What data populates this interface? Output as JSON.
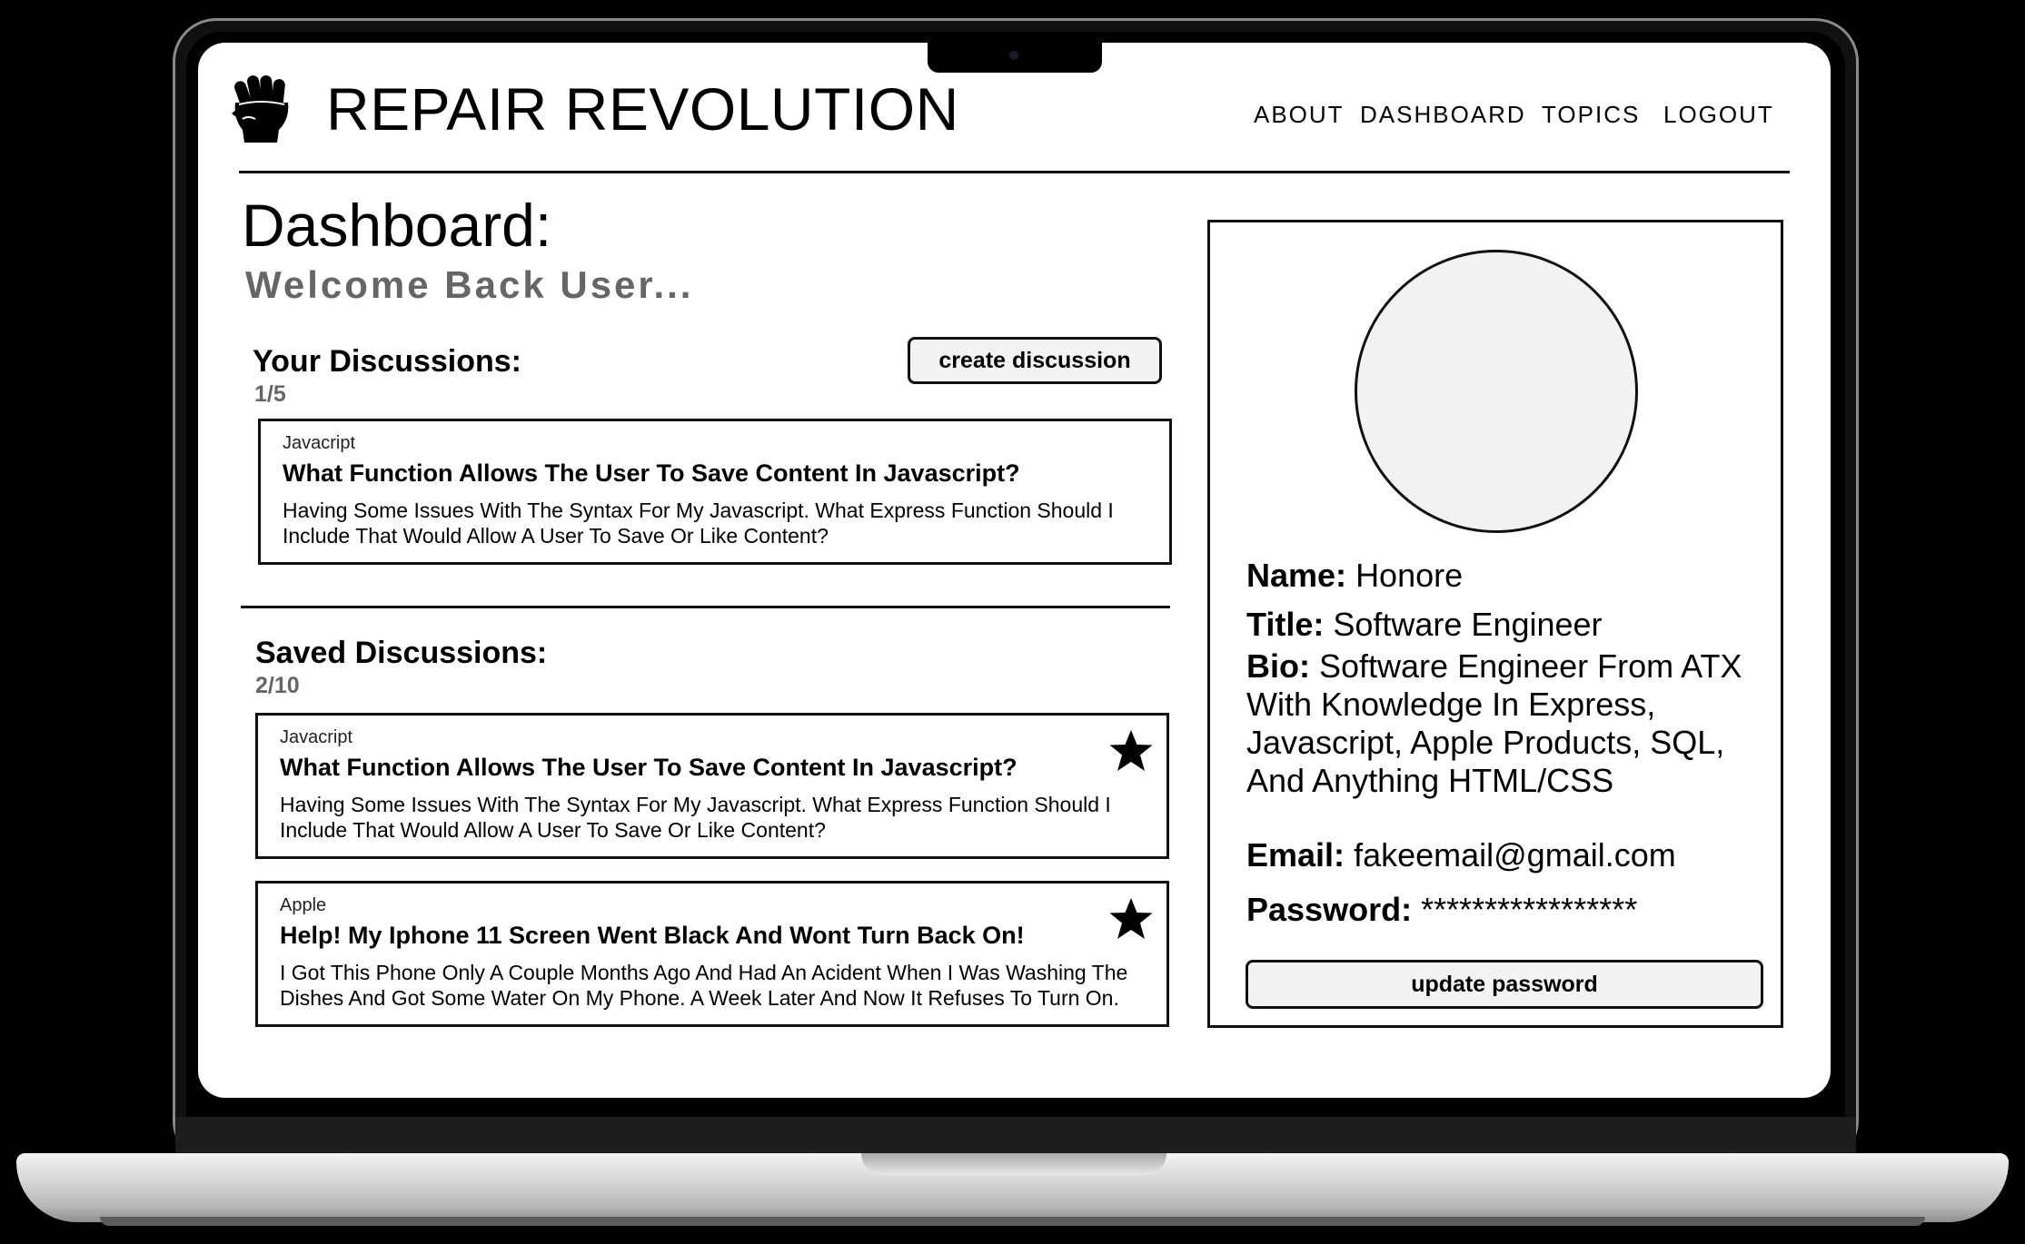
{
  "app": {
    "brand": "REPAIR REVOLUTION"
  },
  "nav": {
    "items": [
      {
        "label": "ABOUT"
      },
      {
        "label": "DASHBOARD"
      },
      {
        "label": "TOPICS"
      },
      {
        "label": "LOGOUT"
      }
    ]
  },
  "dashboard": {
    "title": "Dashboard:",
    "welcome": "Welcome Back User..."
  },
  "your_discussions": {
    "title": "Your Discussions:",
    "count": "1/5",
    "create_label": "create discussion",
    "items": [
      {
        "topic": "Javacript",
        "title": "What Function Allows The User To Save Content In Javascript?",
        "body": "Having Some Issues With The Syntax For My Javascript. What Express Function Should I Include That Would Allow A User To Save Or Like Content?"
      }
    ]
  },
  "saved_discussions": {
    "title": "Saved Discussions:",
    "count": "2/10",
    "items": [
      {
        "topic": "Javacript",
        "title": "What Function Allows The User To Save Content In Javascript?",
        "body": "Having Some Issues With The Syntax For My Javascript. What Express Function Should I Include That Would Allow A User To Save Or Like Content?",
        "starred": true
      },
      {
        "topic": "Apple",
        "title": "Help! My Iphone 11 Screen Went Black And Wont Turn Back On!",
        "body": "I Got This Phone Only A Couple Months Ago And Had An Acident When I Was Washing The Dishes And Got Some Water On My Phone. A Week Later And Now It Refuses To Turn On.",
        "starred": true
      }
    ]
  },
  "profile": {
    "name_label": "Name:",
    "name": "Honore",
    "title_label": "Title:",
    "title": "Software Engineer",
    "bio_label": "Bio:",
    "bio": "Software Engineer From ATX With Knowledge In Express, Javascript, Apple Products, SQL, And Anything HTML/CSS",
    "email_label": "Email:",
    "email": "fakeemail@gmail.com",
    "password_label": "Password:",
    "password": "*****************",
    "update_password_label": "update password"
  },
  "icons": {
    "logo": "raised-fist-icon",
    "saved": "star-icon"
  },
  "colors": {
    "text": "#000000",
    "muted": "#666666",
    "button_bg": "#f3f3f3",
    "avatar_bg": "#f2f2f2"
  }
}
